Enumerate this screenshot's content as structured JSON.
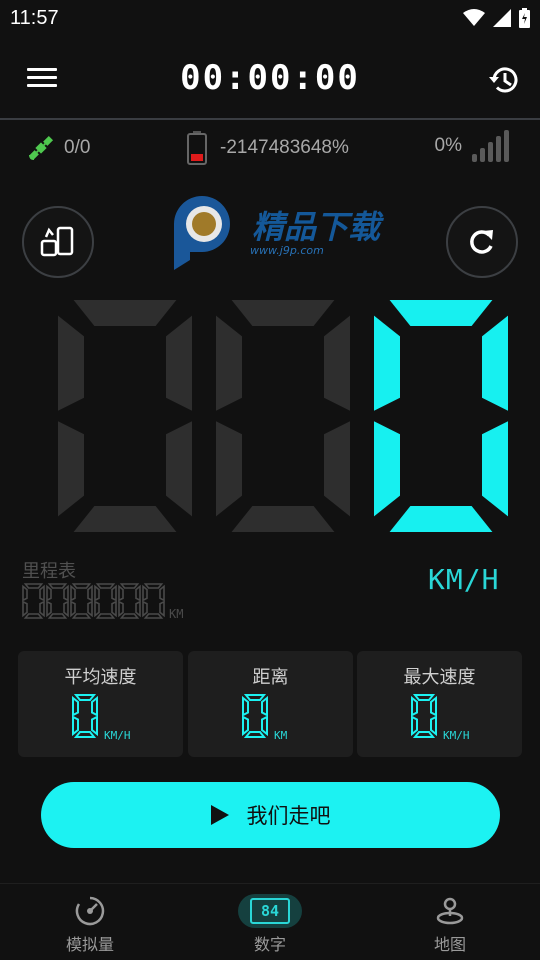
{
  "status_bar": {
    "time": "11:57"
  },
  "header": {
    "timer": "00:00:00"
  },
  "info": {
    "gps": "0/0",
    "battery": "-2147483648%",
    "signal": "0%"
  },
  "watermark": {
    "title": "精品下载",
    "url": "www.j9p.com"
  },
  "speed": {
    "value": "000",
    "unit": "KM/H"
  },
  "odometer": {
    "label": "里程表",
    "value": "000000",
    "unit": "KM"
  },
  "stats": [
    {
      "label": "平均速度",
      "value": "0",
      "unit": "KM/H"
    },
    {
      "label": "距离",
      "value": "0",
      "unit": "KM"
    },
    {
      "label": "最大速度",
      "value": "0",
      "unit": "KM/H"
    }
  ],
  "start_button": {
    "label": "我们走吧"
  },
  "nav": {
    "items": [
      {
        "label": "模拟量",
        "icon": "speedometer-icon"
      },
      {
        "label": "数字",
        "icon": "digital-84-icon",
        "badge": "84",
        "active": true
      },
      {
        "label": "地图",
        "icon": "map-pin-icon"
      }
    ]
  },
  "colors": {
    "accent": "#1cf2f2",
    "lcd_on": "#17f0f0",
    "lcd_off": "#2e2e2e",
    "background": "#111111",
    "card": "#1e1e1e"
  }
}
